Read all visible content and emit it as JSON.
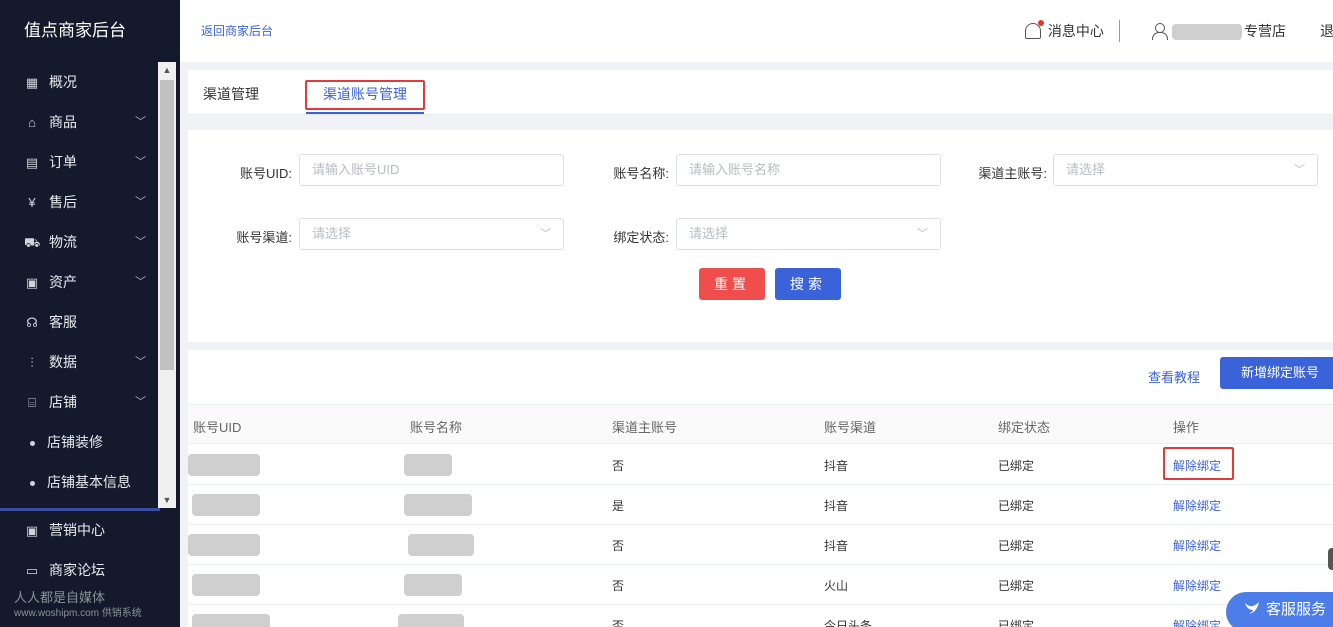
{
  "sidebar": {
    "title": "值点商家后台",
    "items": [
      {
        "label": "概况",
        "icon": "grid-icon",
        "glyph": "▦",
        "expandable": false
      },
      {
        "label": "商品",
        "icon": "bag-icon",
        "glyph": "⌂",
        "expandable": true
      },
      {
        "label": "订单",
        "icon": "order-icon",
        "glyph": "▤",
        "expandable": true
      },
      {
        "label": "售后",
        "icon": "yen-box-icon",
        "glyph": "¥",
        "expandable": true
      },
      {
        "label": "物流",
        "icon": "truck-icon",
        "glyph": "⛟",
        "expandable": true
      },
      {
        "label": "资产",
        "icon": "asset-icon",
        "glyph": "▣",
        "expandable": true
      },
      {
        "label": "客服",
        "icon": "headset-icon",
        "glyph": "☊",
        "expandable": false
      },
      {
        "label": "数据",
        "icon": "bar-chart-icon",
        "glyph": "⫶",
        "expandable": true
      },
      {
        "label": "店铺",
        "icon": "store-icon",
        "glyph": "⌸",
        "expandable": true
      }
    ],
    "sub_items": [
      "店铺装修",
      "店铺基本信息"
    ],
    "bottom_items": [
      {
        "label": "营销中心",
        "icon": "marketing-icon",
        "glyph": "▣"
      },
      {
        "label": "商家论坛",
        "icon": "forum-icon",
        "glyph": "▭"
      }
    ],
    "watermark": "人人都是自媒体",
    "watermark_sub": "www.woshipm.com",
    "watermark_overlap": "供销系统"
  },
  "header": {
    "back_link": "返回商家后台",
    "message_center": "消息中心",
    "store_suffix": "专营店",
    "logout": "退"
  },
  "tabs": [
    {
      "label": "渠道管理",
      "active": false
    },
    {
      "label": "渠道账号管理",
      "active": true
    }
  ],
  "filters": {
    "uid_label": "账号UID:",
    "uid_placeholder": "请输入账号UID",
    "name_label": "账号名称:",
    "name_placeholder": "请输入账号名称",
    "master_label": "渠道主账号:",
    "master_placeholder": "请选择",
    "channel_label": "账号渠道:",
    "channel_placeholder": "请选择",
    "status_label": "绑定状态:",
    "status_placeholder": "请选择",
    "reset_label": "重置",
    "search_label": "搜索"
  },
  "toolbar": {
    "tutorial_label": "查看教程",
    "add_label": "新增绑定账号"
  },
  "table": {
    "headers": [
      "账号UID",
      "账号名称",
      "渠道主账号",
      "账号渠道",
      "绑定状态",
      "操作"
    ],
    "rows": [
      {
        "master": "否",
        "channel": "抖音",
        "status": "已绑定",
        "action": "解除绑定"
      },
      {
        "master": "是",
        "channel": "抖音",
        "status": "已绑定",
        "action": "解除绑定"
      },
      {
        "master": "否",
        "channel": "抖音",
        "status": "已绑定",
        "action": "解除绑定"
      },
      {
        "master": "否",
        "channel": "火山",
        "status": "已绑定",
        "action": "解除绑定"
      },
      {
        "master": "否",
        "channel": "今日头条",
        "status": "已绑定",
        "action": "解除绑定"
      }
    ]
  },
  "customer_service": {
    "label": "客服服务"
  },
  "colors": {
    "sidebar_bg": "#141a2b",
    "primary": "#3b63d9",
    "danger": "#f04d4d",
    "highlight_box": "#e23b3b"
  }
}
